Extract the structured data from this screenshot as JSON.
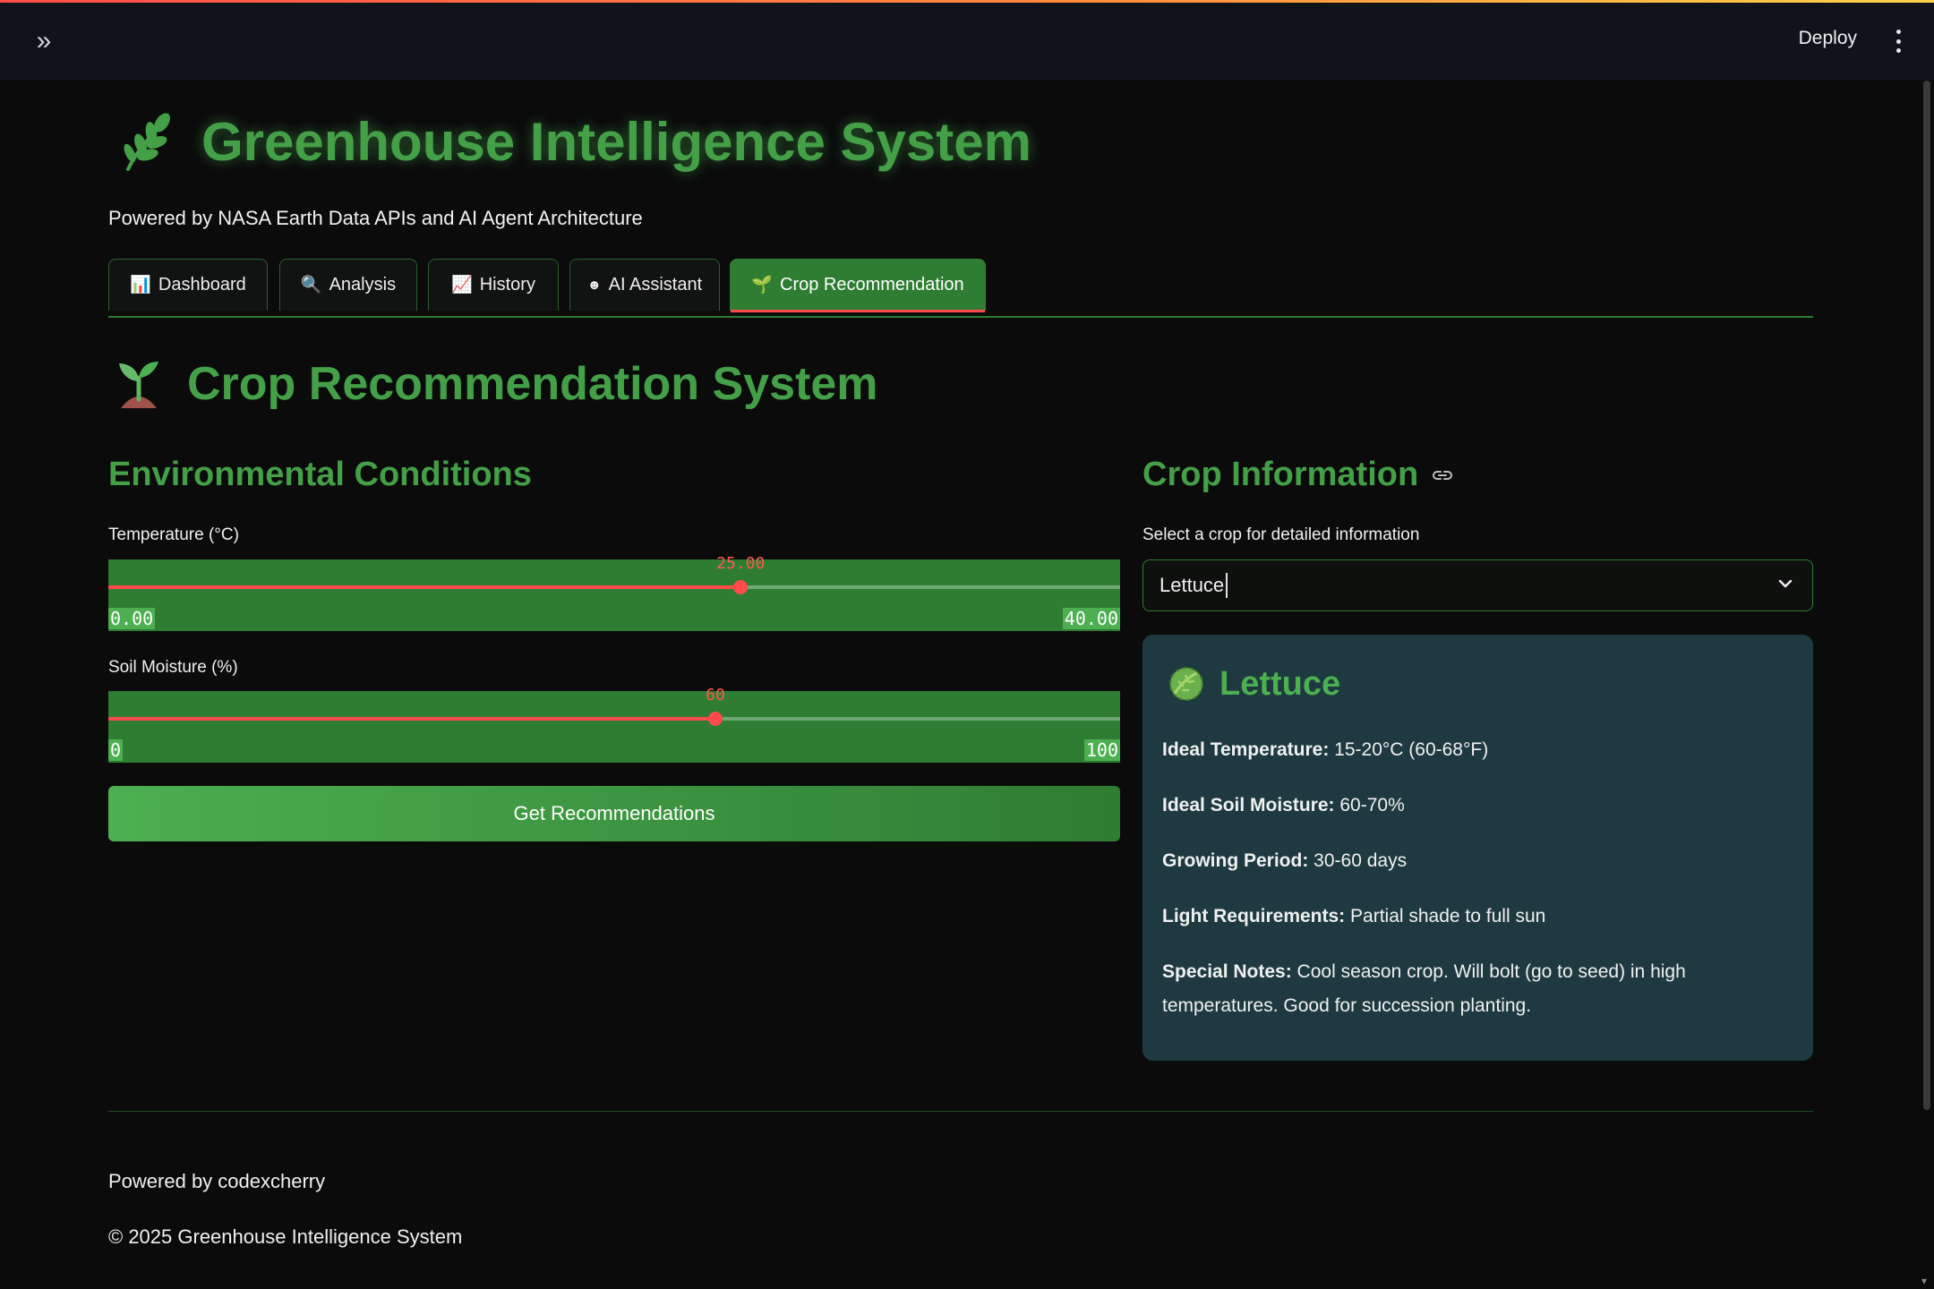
{
  "topbar": {
    "deploy_label": "Deploy"
  },
  "header": {
    "title": "Greenhouse Intelligence System",
    "subtitle": "Powered by NASA Earth Data APIs and AI Agent Architecture"
  },
  "tabs": [
    {
      "icon": "📊",
      "label": "Dashboard"
    },
    {
      "icon": "🔍",
      "label": "Analysis"
    },
    {
      "icon": "📈",
      "label": "History"
    },
    {
      "icon": "☻",
      "label": "AI Assistant"
    },
    {
      "icon": "🌱",
      "label": "Crop Recommendation",
      "active": true
    }
  ],
  "page": {
    "title": "Crop Recommendation System"
  },
  "environment": {
    "title": "Environmental Conditions",
    "temperature": {
      "label": "Temperature (°C)",
      "value": "25.00",
      "min": "0.00",
      "max": "40.00",
      "fraction": 0.625
    },
    "moisture": {
      "label": "Soil Moisture (%)",
      "value": "60",
      "min": "0",
      "max": "100",
      "fraction": 0.6
    },
    "button_label": "Get Recommendations"
  },
  "crop": {
    "title": "Crop Information",
    "select_label": "Select a crop for detailed information",
    "selected": "Lettuce",
    "card": {
      "name": "Lettuce",
      "rows": [
        {
          "key": "Ideal Temperature:",
          "value": " 15-20°C (60-68°F)"
        },
        {
          "key": "Ideal Soil Moisture:",
          "value": " 60-70%"
        },
        {
          "key": "Growing Period:",
          "value": " 30-60 days"
        },
        {
          "key": "Light Requirements:",
          "value": " Partial shade to full sun"
        },
        {
          "key": "Special Notes:",
          "value": " Cool season crop. Will bolt (go to seed) in high temperatures. Good for succession planting."
        }
      ]
    }
  },
  "footer": {
    "powered": "Powered by codexcherry",
    "copyright": "© 2025 Greenhouse Intelligence System"
  },
  "colors": {
    "accent_green": "#43a047",
    "slider_red": "#ff4b4b",
    "card_bg": "#1e3a40"
  }
}
